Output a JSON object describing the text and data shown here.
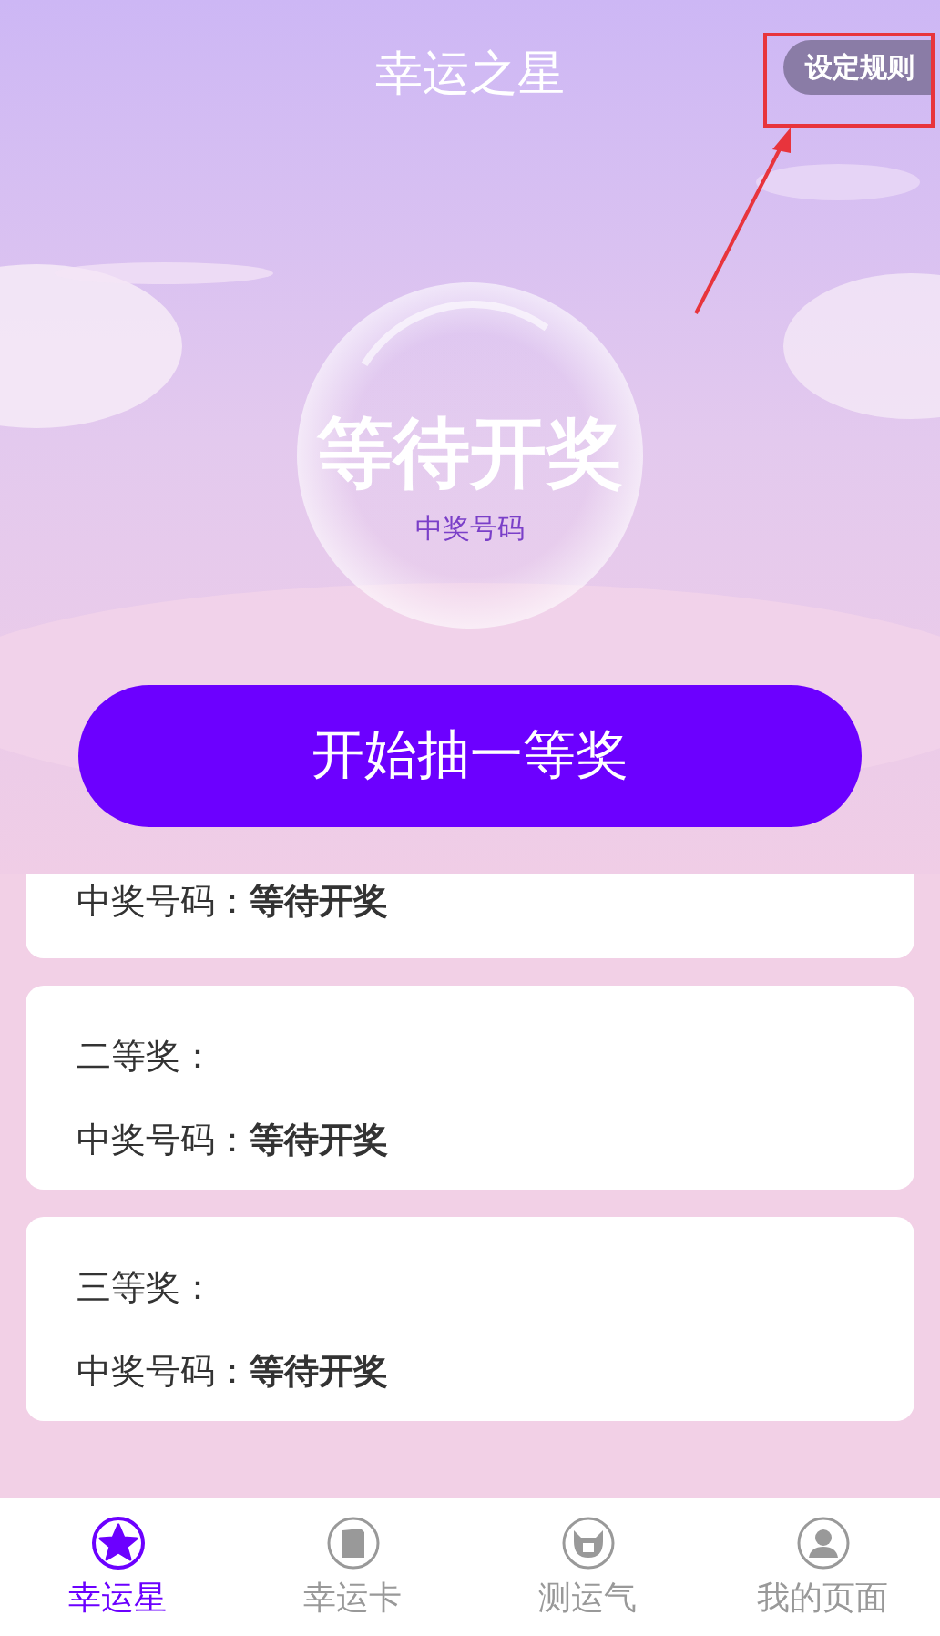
{
  "header": {
    "title": "幸运之星",
    "rules_button": "设定规则"
  },
  "status": {
    "headline": "等待开奖",
    "caption": "中奖号码"
  },
  "start_button": "开始抽一等奖",
  "prizes": [
    {
      "result": "中奖号码：**等待开奖**"
    },
    {
      "label": "二等奖：",
      "result": "中奖号码：**等待开奖**"
    },
    {
      "label": "三等奖：",
      "result": "中奖号码：**等待开奖**"
    }
  ],
  "tabs": [
    {
      "label": "幸运星",
      "selected": true
    },
    {
      "label": "幸运卡",
      "selected": false
    },
    {
      "label": "测运气",
      "selected": false
    },
    {
      "label": "我的页面",
      "selected": false
    }
  ]
}
